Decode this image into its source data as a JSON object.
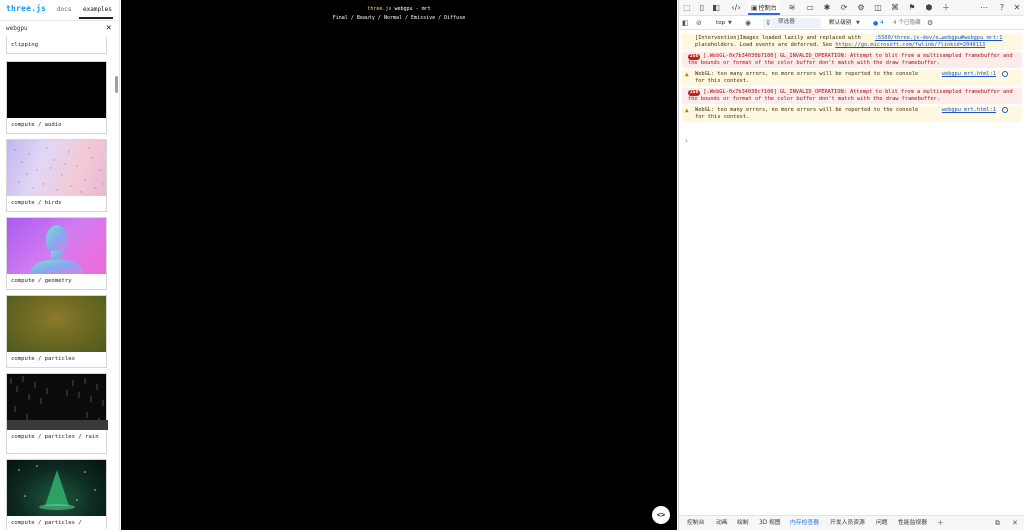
{
  "sidebar": {
    "brand": "three.js",
    "nav": {
      "docs": "docs",
      "examples": "examples"
    },
    "search": {
      "value": "webgpu"
    },
    "clear_icon": "close-icon",
    "items": [
      {
        "label": "clipping"
      },
      {
        "label": "compute / audio"
      },
      {
        "label": "compute / birds"
      },
      {
        "label": "compute / geometry"
      },
      {
        "label": "compute / particles"
      },
      {
        "label": "compute / particles / rain"
      },
      {
        "label": "compute / particles /"
      }
    ]
  },
  "viewport": {
    "title_brand": "three.js",
    "title_rest": " webgpu - mrt",
    "modes": "Final / Beauty / Normal / Emissive / Diffuse",
    "code_button": "<>"
  },
  "devtools": {
    "active_tab": "控制台",
    "toolbar": {
      "context": "top",
      "filter_placeholder": "筛选器",
      "levels": "默认级别",
      "issues_count": "4",
      "hidden": "4 个已隐藏"
    },
    "messages": [
      {
        "type": "warning",
        "text": "[Intervention]Images loaded lazily and replaced with",
        "source": ":5500/three.js-dev/e…webgpu#webgpu_mrt:1",
        "text2": "placeholders. Load events are deferred. See ",
        "link": "https://go.microsoft.com/fwlink/?linkid=2048113"
      },
      {
        "type": "error",
        "count": "256",
        "text": "[.WebGL-0x7b34030b7100] GL_INVALID_OPERATION: Attempt to blit from a multisampled framebuffer and the bounds or format of the color buffer don't match with the draw framebuffer."
      },
      {
        "type": "warning",
        "text": "WebGL: too many errors, no more errors will be reported to the console for this context.",
        "source": "webgpu_mrt.html:1"
      },
      {
        "type": "error",
        "count": "256",
        "text": "[.WebGL-0x7b34030cf100] GL_INVALID_OPERATION: Attempt to blit from a multisampled framebuffer and the bounds or format of the color buffer don't match with the draw framebuffer."
      },
      {
        "type": "warning",
        "text": "WebGL: too many errors, no more errors will be reported to the console for this context.",
        "source": "webgpu_mrt.html:1"
      }
    ],
    "bottom_tabs": [
      "控制台",
      "动画",
      "绘制",
      "3D 视图",
      "内存检查器",
      "开发人员资源",
      "问题",
      "性能监视器"
    ],
    "bottom_active": "内存检查器"
  },
  "colors": {
    "brand": "#049ef4",
    "accent_title": "#ffd84d",
    "error": "#c5221f",
    "warning_bg": "#fff8e1",
    "active_blue": "#1a73e8"
  }
}
